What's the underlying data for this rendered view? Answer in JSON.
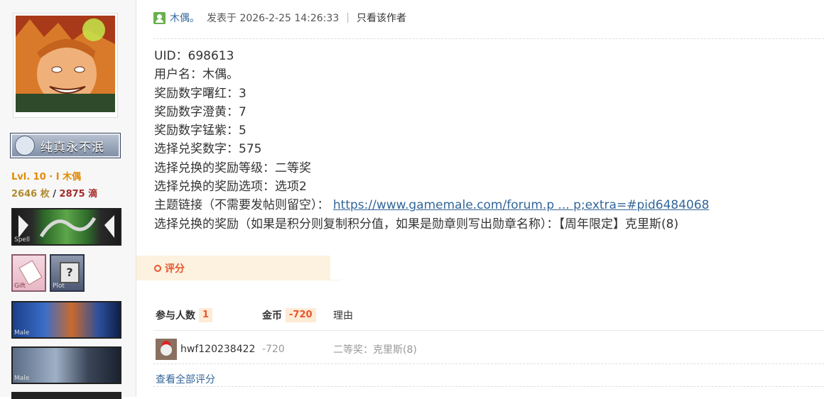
{
  "sidebar": {
    "title_badge": "纯真永不泯",
    "level": "Lvl. 10 · I  木偶",
    "coins": "2646 枚",
    "drops": "2875 滴",
    "medals": [
      {
        "tag": "Spell"
      },
      {
        "tag": "Gift"
      },
      {
        "tag": "Plot"
      },
      {
        "tag": "Male"
      },
      {
        "tag": "Male"
      }
    ]
  },
  "post": {
    "author": "木偶。",
    "posted_at": "发表于 2026-2-25 14:26:33",
    "only_author": "只看该作者",
    "lines": {
      "uid": "UID：698613",
      "username": "用户名：木偶。",
      "red": "奖励数字曙红：3",
      "yellow": "奖励数字澄黄：7",
      "purple": "奖励数字锰紫：5",
      "pick": "选择兑奖数字：575",
      "grade": "选择兑换的奖励等级：二等奖",
      "option": "选择兑换的奖励选项：选项2",
      "topic_prefix": "主题链接（不需要发帖则留空）：",
      "topic_link": "https://www.gamemale.com/forum.p ... p;extra=#pid6484068",
      "reward": "选择兑换的奖励（如果是积分则复制积分值，如果是勋章则写出勋章名称）：【周年限定】克里斯(8)"
    }
  },
  "rating": {
    "section_label": "评分",
    "head_participants": "参与人数",
    "participants_count": "1",
    "head_coins": "金币",
    "coins_total": "-720",
    "head_reason": "理由",
    "rows": [
      {
        "user": "hwf120238422",
        "coins": "-720",
        "reason": "二等奖：克里斯(8)"
      }
    ],
    "view_all": "查看全部评分"
  }
}
